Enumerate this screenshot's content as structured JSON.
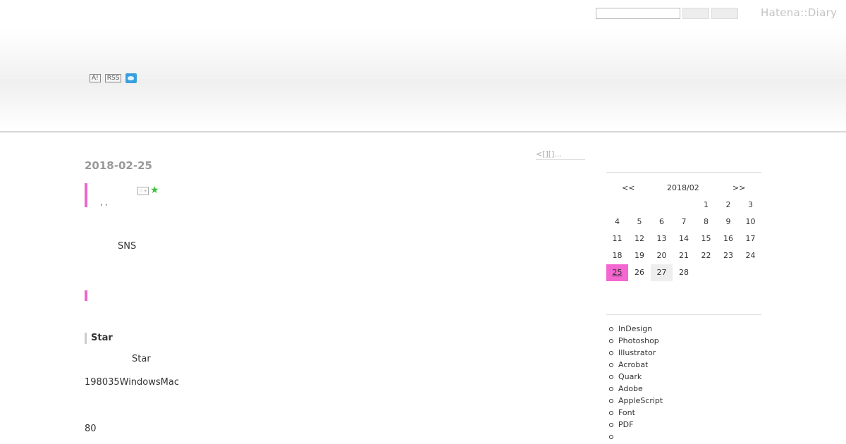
{
  "header": {
    "brand": "Hatena::Diary",
    "search": {
      "value": "",
      "placeholder": ""
    },
    "icons": {
      "a_label": "A!",
      "rss_label": "RSS"
    }
  },
  "entry": {
    "date": "2018-02-25",
    "pager": "<[][]...",
    "commas": ", ,",
    "sns_text": "SNS",
    "heading_star": "Star",
    "star_text": "Star",
    "number_text": "198035WindowsMac",
    "eighty": "80"
  },
  "calendar": {
    "prev": "<<",
    "month": "2018/02",
    "next": ">>",
    "cells": [
      "",
      "",
      "",
      "",
      "1",
      "2",
      "3",
      "4",
      "5",
      "6",
      "7",
      "8",
      "9",
      "10",
      "11",
      "12",
      "13",
      "14",
      "15",
      "16",
      "17",
      "18",
      "19",
      "20",
      "21",
      "22",
      "23",
      "24",
      "25",
      "26",
      "27",
      "28",
      "",
      "",
      ""
    ],
    "today": "25",
    "highlight": "27",
    "today_color": "#f466d0"
  },
  "categories": [
    "InDesign",
    "Photoshop",
    "Illustrator",
    "Acrobat",
    "Quark",
    "Adobe",
    "AppleScript",
    "Font",
    "PDF",
    ""
  ],
  "colors": {
    "accent": "#ee66cc",
    "star": "#3bbf3b",
    "brand": "#c4c4c4"
  }
}
